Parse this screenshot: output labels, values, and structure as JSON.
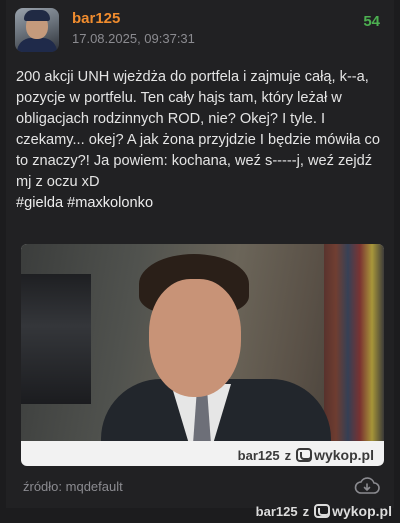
{
  "post": {
    "author": "bar125",
    "date": "17.08.2025, 09:37:31",
    "votes": "54",
    "text": "200 akcji UNH wjeżdża do portfela i zajmuje całą, k--a, pozycje w portfelu. Ten cały hajs tam, który leżał w obligacjach rodzinnych ROD, nie? Okej? I tyle. I czekamy... okej? A jak żona przyjdzie I będzie mówiła co to znaczy?! Ja powiem: kochana, weź s-----j, weź zejdź mj z oczu xD",
    "tags": [
      "#gielda",
      "#maxkolonko"
    ],
    "source": "źródło: mqdefault"
  },
  "media_watermark": {
    "user": "bar125",
    "sep": "z",
    "site": "wykop.pl"
  },
  "footer_watermark": {
    "user": "bar125",
    "sep": "z",
    "site": "wykop.pl"
  },
  "icons": {
    "download": "cloud-download-icon",
    "avatar": "user-avatar",
    "wykop_logo": "wykop-logo-icon"
  },
  "colors": {
    "username": "#f08c2e",
    "votes": "#4caf50",
    "background": "#212123"
  }
}
